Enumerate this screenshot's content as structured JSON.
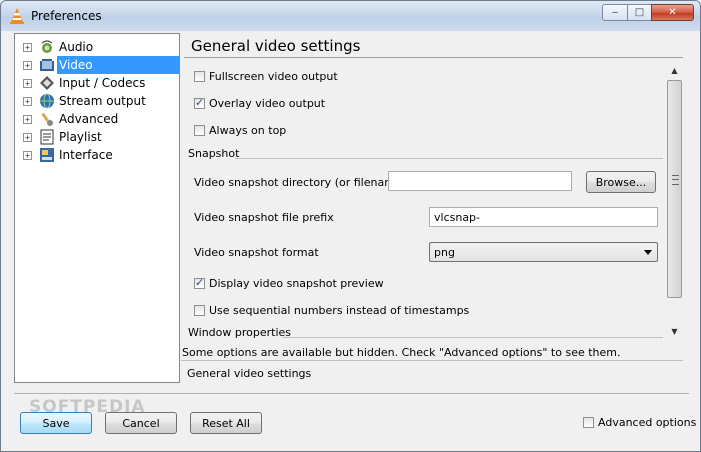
{
  "window": {
    "title": "Preferences",
    "controls": {
      "minimize": "‒",
      "maximize": "□",
      "close": "✕"
    }
  },
  "tree": {
    "items": [
      {
        "label": "Audio",
        "icon": "audio-icon",
        "selected": false
      },
      {
        "label": "Video",
        "icon": "video-icon",
        "selected": true
      },
      {
        "label": "Input / Codecs",
        "icon": "codecs-icon",
        "selected": false
      },
      {
        "label": "Stream output",
        "icon": "stream-output-icon",
        "selected": false
      },
      {
        "label": "Advanced",
        "icon": "advanced-icon",
        "selected": false
      },
      {
        "label": "Playlist",
        "icon": "playlist-icon",
        "selected": false
      },
      {
        "label": "Interface",
        "icon": "interface-icon",
        "selected": false
      }
    ],
    "expander": "+"
  },
  "panel": {
    "title": "General video settings",
    "options": {
      "fullscreen": {
        "label": "Fullscreen video output",
        "checked": false
      },
      "overlay": {
        "label": "Overlay video output",
        "checked": true
      },
      "always_on_top": {
        "label": "Always on top",
        "checked": false
      }
    },
    "snapshot": {
      "section_label": "Snapshot",
      "directory_label": "Video snapshot directory (or filename)",
      "directory_value": "",
      "browse_label": "Browse...",
      "prefix_label": "Video snapshot file prefix",
      "prefix_value": "vlcsnap-",
      "format_label": "Video snapshot format",
      "format_value": "png",
      "preview": {
        "label": "Display video snapshot preview",
        "checked": true
      },
      "sequential": {
        "label": "Use sequential numbers instead of timestamps",
        "checked": false
      }
    },
    "window_section_label": "Window properties"
  },
  "hint": "Some options are available but hidden. Check \"Advanced options\" to see them.",
  "status_label": "General video settings",
  "footer": {
    "save_label": "Save",
    "cancel_label": "Cancel",
    "reset_label": "Reset All",
    "advanced_options_label": "Advanced options",
    "advanced_options_checked": false
  },
  "watermark": "SOFTPEDIA",
  "colors": {
    "selection": "#3399ff",
    "title_bar": "#c6d6ea",
    "close_button": "#c3391f"
  }
}
